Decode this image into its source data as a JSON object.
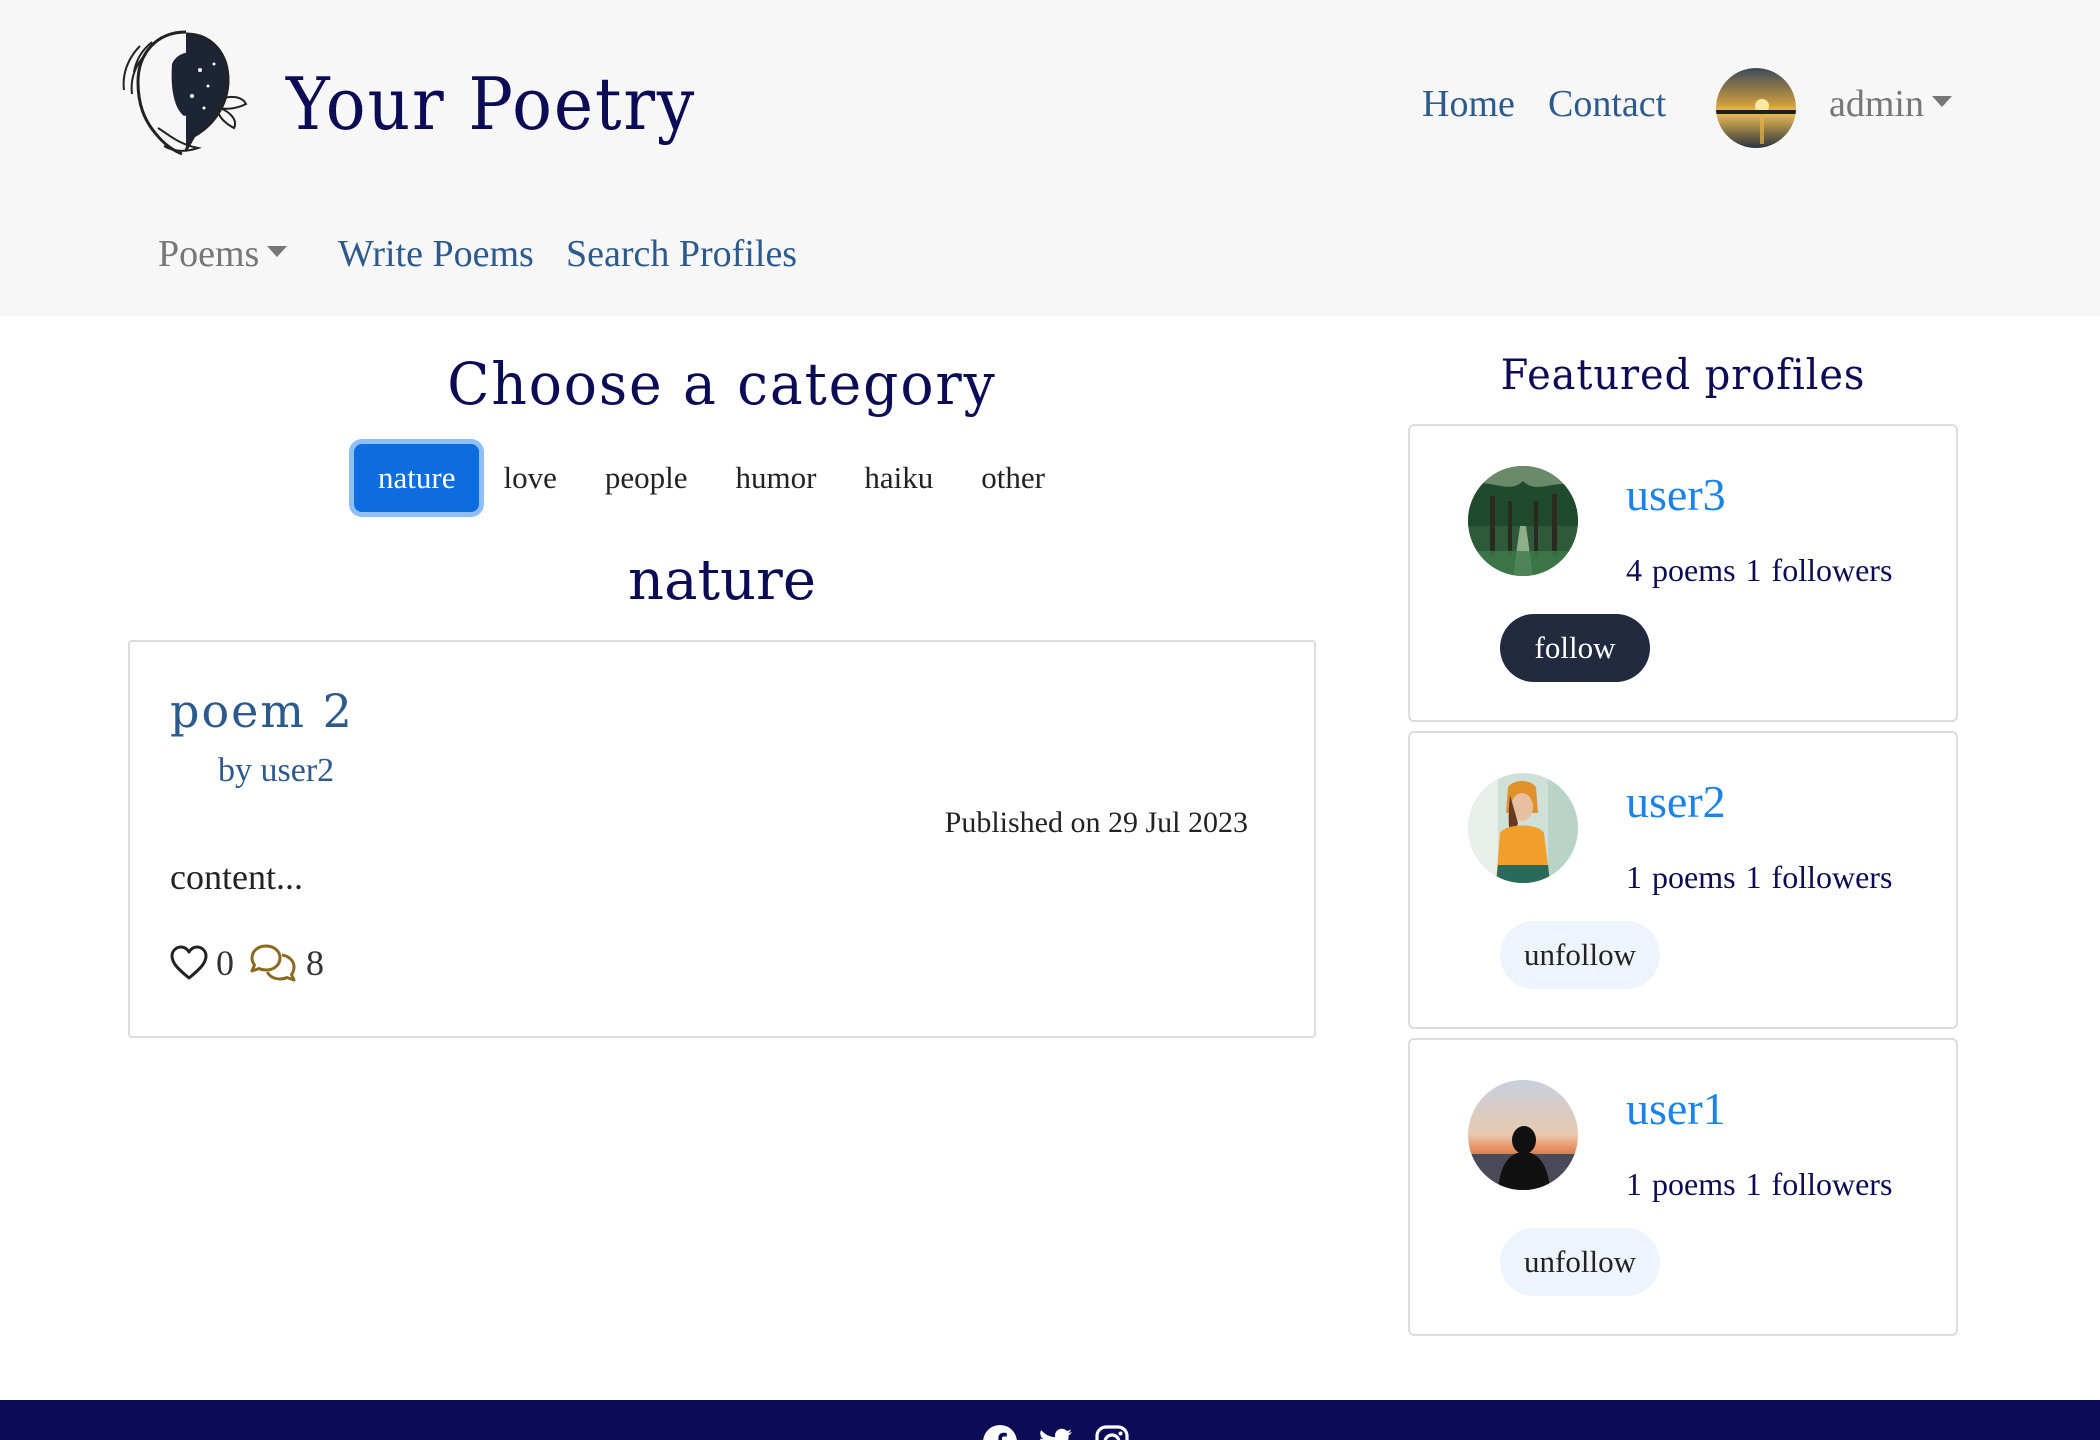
{
  "header": {
    "brand": "Your Poetry",
    "nav": {
      "home": "Home",
      "contact": "Contact"
    },
    "user_menu": {
      "label": "admin"
    },
    "sub_nav": {
      "poems": "Poems",
      "write": "Write Poems",
      "search": "Search Profiles"
    }
  },
  "main": {
    "choose_title": "Choose a category",
    "categories": [
      "nature",
      "love",
      "people",
      "humor",
      "haiku",
      "other"
    ],
    "active_category": "nature",
    "category_heading": "nature",
    "poems": [
      {
        "title": "poem 2",
        "author": "by user2",
        "published": "Published on 29 Jul 2023",
        "content": "content...",
        "likes": "0",
        "comments": "8"
      }
    ]
  },
  "sidebar": {
    "title": "Featured profiles",
    "profiles": [
      {
        "name": "user3",
        "stats": "4 poems  1 followers",
        "button": "follow",
        "avatar": "forest-path"
      },
      {
        "name": "user2",
        "stats": "1 poems  1 followers",
        "button": "unfollow",
        "avatar": "woman-yellow-hoodie"
      },
      {
        "name": "user1",
        "stats": "1 poems  1 followers",
        "button": "unfollow",
        "avatar": "person-sunset"
      }
    ]
  },
  "footer": {
    "icons": [
      "facebook-icon",
      "twitter-icon",
      "instagram-icon"
    ]
  },
  "colors": {
    "brand": "#0b0c55",
    "link": "#2d5a8c",
    "accent": "#0d6de0",
    "profile_link": "#1a82e8",
    "footer": "#0b0c55"
  }
}
